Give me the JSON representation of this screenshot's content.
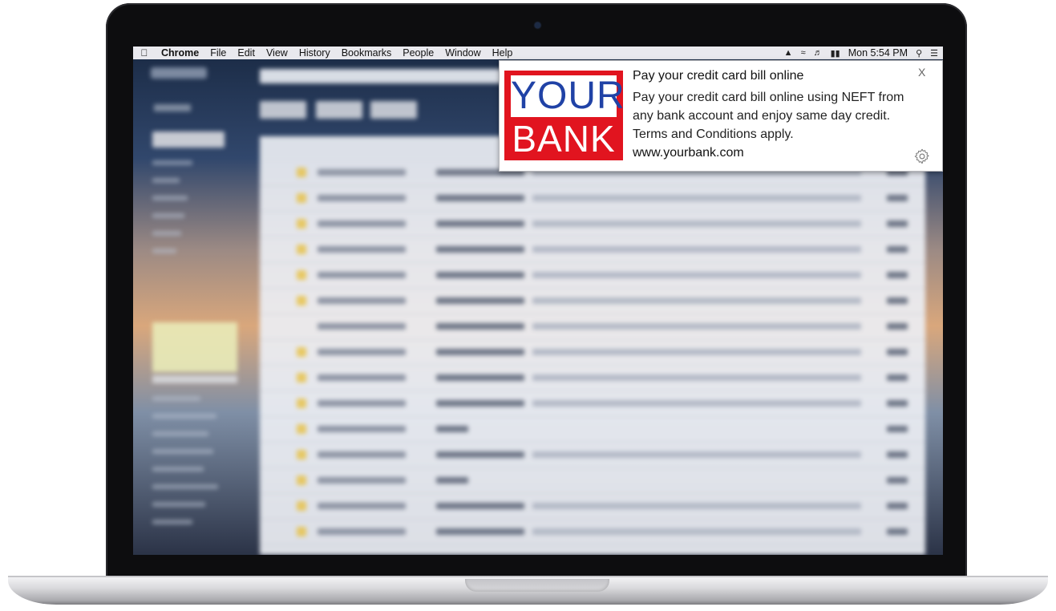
{
  "menubar": {
    "apple_icon": "apple-logo-icon",
    "items": [
      "Chrome",
      "File",
      "Edit",
      "View",
      "History",
      "Bookmarks",
      "People",
      "Window",
      "Help"
    ],
    "clock": "Mon 5:54 PM",
    "status_icons": [
      "notification-icon",
      "wifi-icon",
      "volume-icon",
      "battery-icon",
      "search-icon",
      "menu-list-icon"
    ]
  },
  "notification": {
    "logo_top": "YOUR",
    "logo_bottom": "BANK",
    "title": "Pay your credit card bill online",
    "body": "Pay your credit card bill online using NEFT from any bank account and enjoy same day credit. Terms and Conditions apply.",
    "url": "www.yourbank.com",
    "close_label": "X",
    "settings_icon": "gear-icon"
  },
  "colors": {
    "logo_red": "#e1141f",
    "logo_blue": "#2042a6",
    "menubar_bg": "#e9e9ee"
  }
}
